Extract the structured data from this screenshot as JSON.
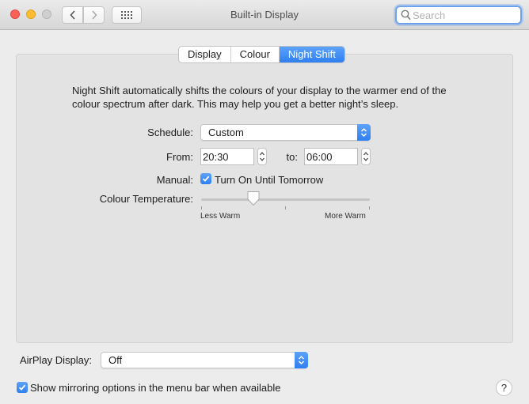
{
  "window": {
    "title": "Built-in Display"
  },
  "search": {
    "placeholder": "Search",
    "value": ""
  },
  "tabs": [
    {
      "label": "Display",
      "active": false
    },
    {
      "label": "Colour",
      "active": false
    },
    {
      "label": "Night Shift",
      "active": true
    }
  ],
  "night_shift": {
    "description": "Night Shift automatically shifts the colours of your display to the warmer end of the colour spectrum after dark. This may help you get a better night’s sleep.",
    "schedule_label": "Schedule:",
    "schedule_value": "Custom",
    "from_label": "From:",
    "from_value": "20:30",
    "to_label": "to:",
    "to_value": "06:00",
    "manual_label": "Manual:",
    "manual_checkbox_label": "Turn On Until Tomorrow",
    "manual_checked": true,
    "temperature_label": "Colour Temperature:",
    "temperature_level": 0.31,
    "less_warm_label": "Less Warm",
    "more_warm_label": "More Warm"
  },
  "airplay": {
    "label": "AirPlay Display:",
    "value": "Off"
  },
  "mirroring": {
    "label": "Show mirroring options in the menu bar when available",
    "checked": true
  },
  "help": {
    "label": "?"
  },
  "colors": {
    "accent": "#2f7ff2",
    "close": "#fe5f57",
    "minimize": "#febc2e",
    "zoom_disabled": "#cfcfcf"
  },
  "icons": {
    "back": "chevron-left-icon",
    "forward": "chevron-right-icon",
    "show_all": "grid-icon",
    "search": "search-icon",
    "dropdown": "updown-chevron-icon",
    "checkbox": "checkmark-icon"
  }
}
